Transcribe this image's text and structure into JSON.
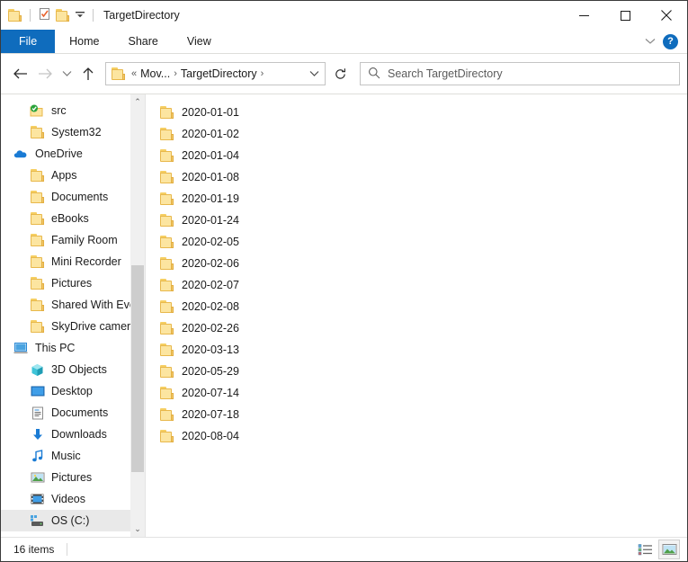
{
  "window": {
    "title": "TargetDirectory",
    "quick_access": [
      {
        "name": "folder-icon",
        "label": "folder"
      },
      {
        "name": "properties-icon",
        "label": "properties"
      },
      {
        "name": "new-folder-icon",
        "label": "new folder"
      },
      {
        "name": "customize-dropdown-icon",
        "label": "customize quick access toolbar"
      }
    ],
    "controls": {
      "minimize": "—",
      "maximize": "□",
      "close": "✕"
    }
  },
  "ribbon": {
    "tabs": [
      {
        "label": "File",
        "active": true
      },
      {
        "label": "Home",
        "active": false
      },
      {
        "label": "Share",
        "active": false
      },
      {
        "label": "View",
        "active": false
      }
    ],
    "expand_label": "⌄",
    "help_label": "?"
  },
  "addressbar": {
    "back": "←",
    "forward": "→",
    "recent": "⌄",
    "up": "↑",
    "crumb_overflow": "«",
    "crumbs": [
      "Mov...",
      "TargetDirectory"
    ],
    "separator": "›",
    "dropdown": "⌄",
    "refresh": "↻"
  },
  "search": {
    "placeholder": "Search TargetDirectory",
    "value": ""
  },
  "sidebar": {
    "items": [
      {
        "label": "src",
        "icon": "folder-sync-icon",
        "indent": true
      },
      {
        "label": "System32",
        "icon": "folder-icon",
        "indent": true
      },
      {
        "label": "OneDrive",
        "icon": "onedrive-cloud-icon",
        "indent": false
      },
      {
        "label": "Apps",
        "icon": "folder-icon",
        "indent": true
      },
      {
        "label": "Documents",
        "icon": "folder-icon",
        "indent": true
      },
      {
        "label": "eBooks",
        "icon": "folder-icon",
        "indent": true
      },
      {
        "label": "Family Room",
        "icon": "folder-icon",
        "indent": true
      },
      {
        "label": "Mini Recorder",
        "icon": "folder-icon",
        "indent": true
      },
      {
        "label": "Pictures",
        "icon": "folder-icon",
        "indent": true
      },
      {
        "label": "Shared With Eve",
        "icon": "folder-icon",
        "indent": true
      },
      {
        "label": "SkyDrive camera",
        "icon": "folder-icon",
        "indent": true
      },
      {
        "label": "This PC",
        "icon": "this-pc-icon",
        "indent": false
      },
      {
        "label": "3D Objects",
        "icon": "3d-objects-icon",
        "indent": true
      },
      {
        "label": "Desktop",
        "icon": "desktop-icon",
        "indent": true
      },
      {
        "label": "Documents",
        "icon": "documents-icon",
        "indent": true
      },
      {
        "label": "Downloads",
        "icon": "downloads-icon",
        "indent": true
      },
      {
        "label": "Music",
        "icon": "music-icon",
        "indent": true
      },
      {
        "label": "Pictures",
        "icon": "pictures-icon",
        "indent": true
      },
      {
        "label": "Videos",
        "icon": "videos-icon",
        "indent": true
      },
      {
        "label": "OS (C:)",
        "icon": "disk-drive-icon",
        "indent": true,
        "selected": true
      }
    ],
    "scroll_up": "⌃",
    "scroll_down": "⌄"
  },
  "files": {
    "items": [
      {
        "name": "2020-01-01",
        "icon": "folder-icon"
      },
      {
        "name": "2020-01-02",
        "icon": "folder-icon"
      },
      {
        "name": "2020-01-04",
        "icon": "folder-icon"
      },
      {
        "name": "2020-01-08",
        "icon": "folder-icon"
      },
      {
        "name": "2020-01-19",
        "icon": "folder-icon"
      },
      {
        "name": "2020-01-24",
        "icon": "folder-icon"
      },
      {
        "name": "2020-02-05",
        "icon": "folder-icon"
      },
      {
        "name": "2020-02-06",
        "icon": "folder-icon"
      },
      {
        "name": "2020-02-07",
        "icon": "folder-icon"
      },
      {
        "name": "2020-02-08",
        "icon": "folder-icon"
      },
      {
        "name": "2020-02-26",
        "icon": "folder-icon"
      },
      {
        "name": "2020-03-13",
        "icon": "folder-icon"
      },
      {
        "name": "2020-05-29",
        "icon": "folder-icon"
      },
      {
        "name": "2020-07-14",
        "icon": "folder-icon"
      },
      {
        "name": "2020-07-18",
        "icon": "folder-icon"
      },
      {
        "name": "2020-08-04",
        "icon": "folder-icon"
      }
    ]
  },
  "statusbar": {
    "item_count": "16 items",
    "views": [
      {
        "name": "details-view-button",
        "active": false
      },
      {
        "name": "large-icons-view-button",
        "active": true
      }
    ]
  },
  "colors": {
    "accent": "#0f6cbd",
    "folder_fill": "#fce5a0",
    "folder_edge": "#e8b84b",
    "selection": "#e9e9e9"
  }
}
